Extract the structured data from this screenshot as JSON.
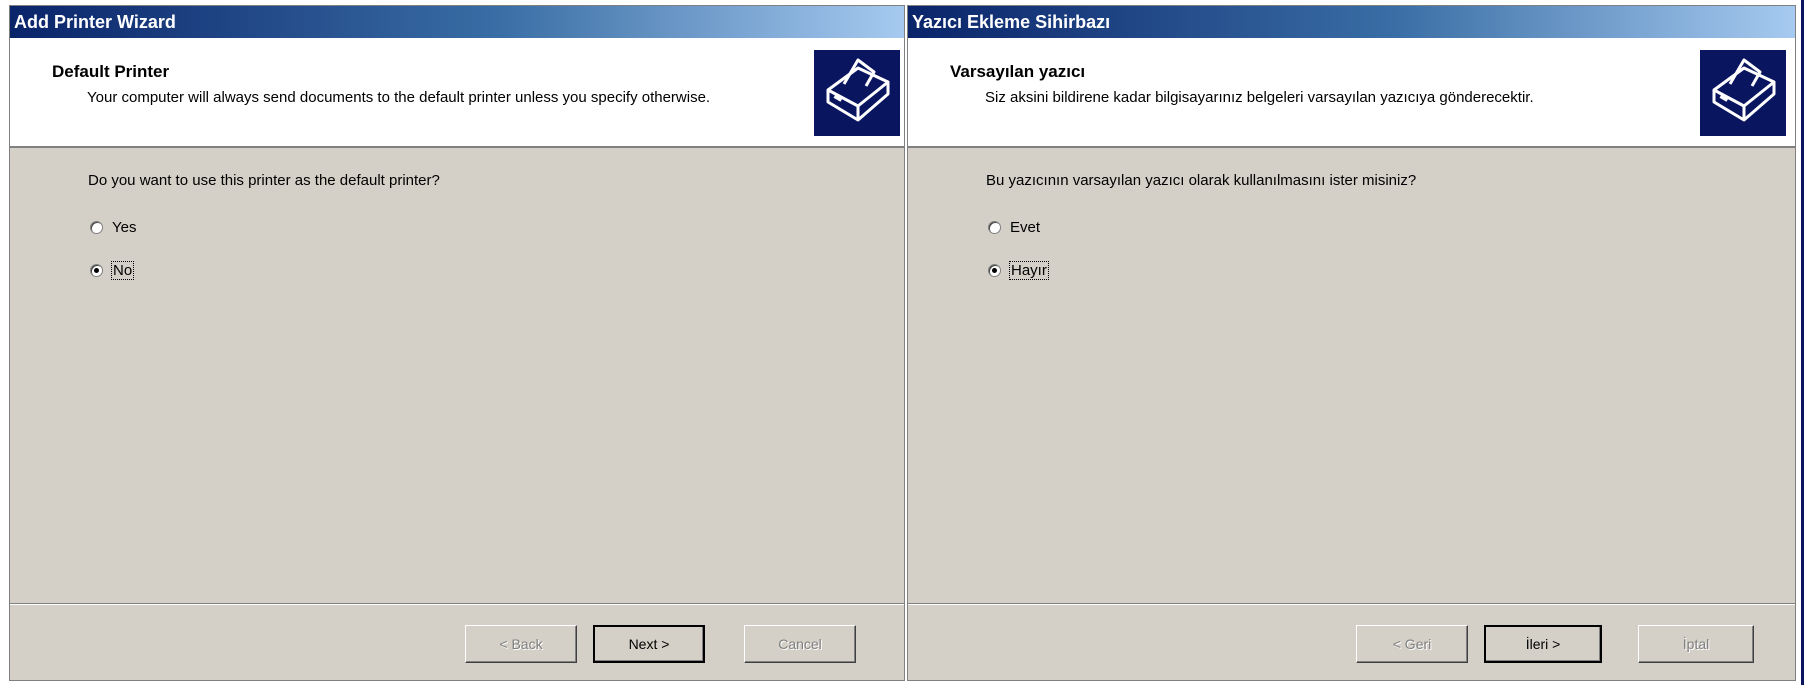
{
  "dialogs": [
    {
      "title": "Add Printer Wizard",
      "header_title": "Default Printer",
      "header_subtitle": "Your computer will always send documents to the default printer unless you specify otherwise.",
      "question": "Do you want to use this printer as the default printer?",
      "options": [
        {
          "label": "Yes",
          "checked": false
        },
        {
          "label": "No",
          "checked": true
        }
      ],
      "buttons": {
        "back": "< Back",
        "next": "Next >",
        "cancel": "Cancel"
      }
    },
    {
      "title": "Yazıcı Ekleme Sihirbazı",
      "header_title": "Varsayılan yazıcı",
      "header_subtitle": "Siz aksini bildirene kadar bilgisayarınız belgeleri varsayılan yazıcıya gönderecektir.",
      "question": "Bu yazıcının varsayılan yazıcı olarak kullanılmasını ister misiniz?",
      "options": [
        {
          "label": "Evet",
          "checked": false
        },
        {
          "label": "Hayır",
          "checked": true
        }
      ],
      "buttons": {
        "back": "< Geri",
        "next": "İleri >",
        "cancel": "İptal"
      }
    }
  ],
  "icons": {
    "header": "printer-icon"
  },
  "colors": {
    "title_bar": "#0a246a",
    "face": "#d4d0c8",
    "header_icon_bg": "#0a1560"
  }
}
